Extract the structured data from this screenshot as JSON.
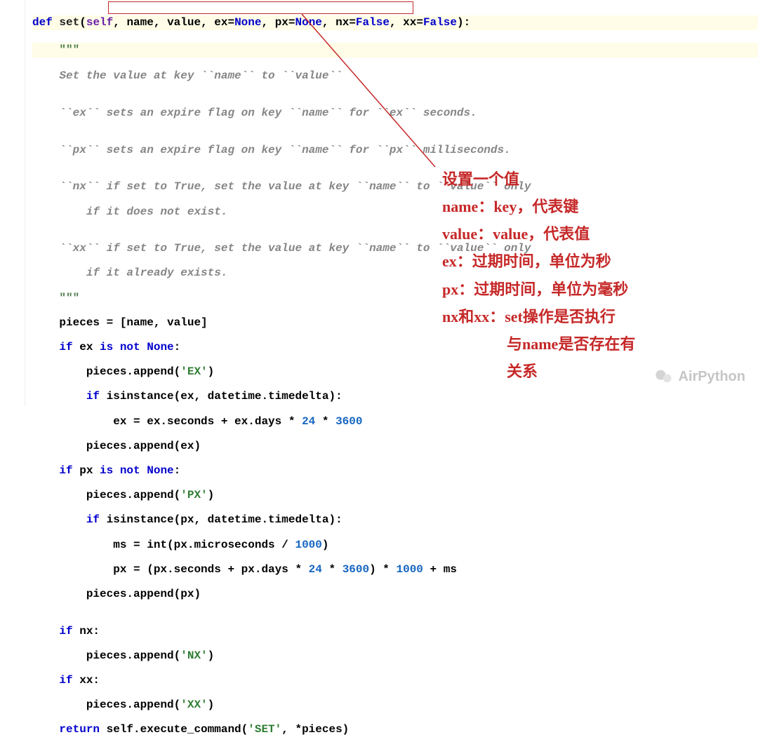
{
  "code": {
    "sig_def": "def",
    "sig_fn": "set",
    "sig_open": "(",
    "sig_self": "self",
    "sig_rest1": ", name, value, ex=",
    "sig_none1": "None",
    "sig_rest2": ", px=",
    "sig_none2": "None",
    "sig_rest3": ", nx=",
    "sig_false1": "False",
    "sig_rest4": ", xx=",
    "sig_false2": "False",
    "sig_close": "):",
    "doc_open": "    \"\"\"",
    "doc1": "    Set the value at key ``name`` to ``value``",
    "doc2": "",
    "doc3": "    ``ex`` sets an expire flag on key ``name`` for ``ex`` seconds.",
    "doc4": "",
    "doc5": "    ``px`` sets an expire flag on key ``name`` for ``px`` milliseconds.",
    "doc6": "",
    "doc7": "    ``nx`` if set to True, set the value at key ``name`` to ``value`` only",
    "doc8": "        if it does not exist.",
    "doc9": "",
    "doc10": "    ``xx`` if set to True, set the value at key ``name`` to ``value`` only",
    "doc11": "        if it already exists.",
    "doc_close": "    \"\"\"",
    "l_pieces": "    pieces = [name, value]",
    "l_if_ex": "    if",
    "l_if_ex_rest": " ex ",
    "l_isnot": "is not",
    "l_none": "None",
    "l_colon": ":",
    "l_app_ex": "        pieces.append(",
    "l_str_ex": "'EX'",
    "l_close": ")",
    "l_if_isinst": "        if",
    "l_isinst": " isinstance(ex, datetime.timedelta):",
    "l_ex_calc_pre": "            ex = ex.seconds + ex.days * ",
    "l_24": "24",
    "l_mul": " * ",
    "l_3600": "3600",
    "l_app_ex2": "        pieces.append(ex)",
    "l_if_px": "    if",
    "l_if_px_rest": " px ",
    "l_app_px": "        pieces.append(",
    "l_str_px": "'PX'",
    "l_isinst_px": " isinstance(px, datetime.timedelta):",
    "l_ms_pre": "            ms = int(px.microseconds / ",
    "l_1000": "1000",
    "l_px_calc_pre": "            px = (px.seconds + px.days * ",
    "l_px_calc_mid": ") * ",
    "l_px_calc_end": " + ms",
    "l_app_px2": "        pieces.append(px)",
    "l_blank": "",
    "l_if_nx": "    if",
    "l_nx": " nx:",
    "l_app_nx": "        pieces.append(",
    "l_str_nx": "'NX'",
    "l_if_xx": "    if",
    "l_xx": " xx:",
    "l_app_xx": "        pieces.append(",
    "l_str_xx": "'XX'",
    "l_return": "    return",
    "l_return_rest": " self.execute_command(",
    "l_str_set": "'SET'",
    "l_return_end": ", *pieces)"
  },
  "annotations": {
    "a1": "设置一个值",
    "a2": "name：key，代表键",
    "a3": "value：value，代表值",
    "a4": "ex：过期时间，单位为秒",
    "a5": "px：过期时间，单位为毫秒",
    "a6": "nx和xx：set操作是否执行",
    "a7": "与name是否存在有",
    "a8": "关系"
  },
  "watermark": "AirPython"
}
